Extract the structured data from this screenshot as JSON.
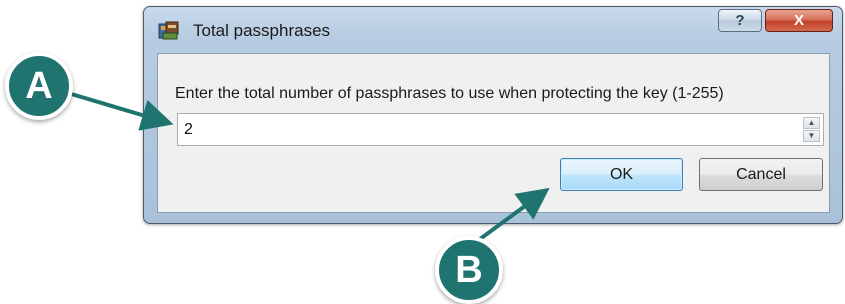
{
  "dialog": {
    "title": "Total passphrases",
    "help_label": "?",
    "close_label": "X",
    "prompt": "Enter the total number of passphrases to use when protecting the key (1-255)",
    "spin_value": "2",
    "ok_label": "OK",
    "cancel_label": "Cancel"
  },
  "callouts": {
    "a_label": "A",
    "b_label": "B",
    "color": "#1f7470"
  },
  "icons": {
    "app": "app-window-icon",
    "spin_up": "spin-up-icon",
    "spin_down": "spin-down-icon"
  }
}
